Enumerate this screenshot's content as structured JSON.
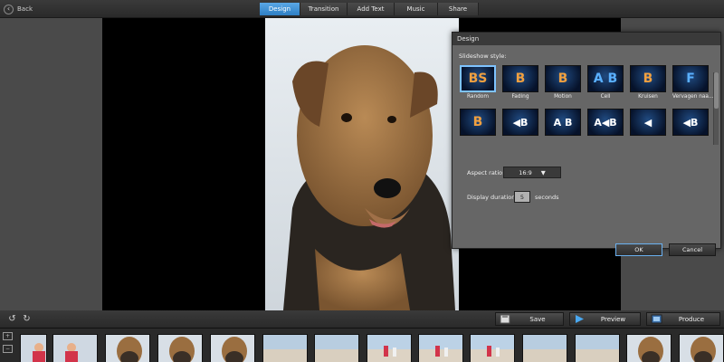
{
  "header": {
    "back_label": "Back",
    "tabs": [
      {
        "label": "Design",
        "active": true
      },
      {
        "label": "Transition",
        "active": false
      },
      {
        "label": "Add Text",
        "active": false
      },
      {
        "label": "Music",
        "active": false
      },
      {
        "label": "Share",
        "active": false
      }
    ]
  },
  "dialog": {
    "title": "Design",
    "slideshow_style_label": "Slideshow style:",
    "styles": [
      {
        "name": "Random",
        "glyph": "BS",
        "kind": "random",
        "selected": true
      },
      {
        "name": "Fading",
        "glyph": "B",
        "kind": "fade",
        "selected": false
      },
      {
        "name": "Motion",
        "glyph": "B",
        "kind": "motion",
        "selected": false
      },
      {
        "name": "Cell",
        "glyph": "A B",
        "kind": "cell",
        "selected": false
      },
      {
        "name": "Kruisen",
        "glyph": "B",
        "kind": "cross",
        "selected": false
      },
      {
        "name": "Vervagen naa...",
        "glyph": "F",
        "kind": "wipe",
        "selected": false
      },
      {
        "name": "",
        "glyph": "B",
        "kind": "b",
        "selected": false
      },
      {
        "name": "",
        "glyph": "◀B",
        "kind": "arrow",
        "selected": false
      },
      {
        "name": "",
        "glyph": "A B",
        "kind": "arrow",
        "selected": false
      },
      {
        "name": "",
        "glyph": "A◀B",
        "kind": "arrow",
        "selected": false
      },
      {
        "name": "",
        "glyph": "◀",
        "kind": "arrow",
        "selected": false
      },
      {
        "name": "",
        "glyph": "◀B",
        "kind": "arrow",
        "selected": false
      }
    ],
    "aspect_ratio_label": "Aspect ratio:",
    "aspect_ratio_value": "16:9",
    "display_duration_label": "Display duration:",
    "display_duration_value": "5",
    "display_duration_unit": "seconds",
    "ok_label": "OK",
    "cancel_label": "Cancel"
  },
  "actions": {
    "save_label": "Save",
    "preview_label": "Preview",
    "produce_label": "Produce"
  },
  "colors": {
    "accent": "#2e7fc4",
    "background": "#3c3c3c",
    "dialog": "#666666"
  },
  "filmstrip": {
    "thumbnails": [
      "people",
      "people",
      "dog",
      "dog",
      "dog",
      "beach",
      "beach",
      "beach-people",
      "beach-people",
      "beach-people",
      "beach",
      "beach",
      "dog",
      "dog"
    ]
  }
}
